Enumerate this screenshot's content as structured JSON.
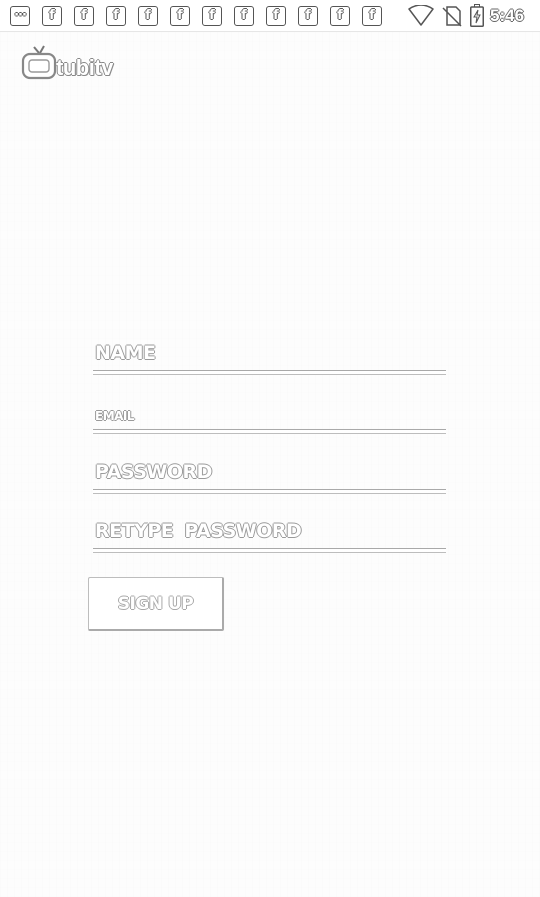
{
  "status_bar": {
    "notifications": [
      {
        "icon": "more-dots-icon",
        "glyph": "···"
      },
      {
        "icon": "facebook-icon",
        "glyph": "f"
      },
      {
        "icon": "facebook-icon",
        "glyph": "f"
      },
      {
        "icon": "facebook-icon",
        "glyph": "f"
      },
      {
        "icon": "facebook-icon",
        "glyph": "f"
      },
      {
        "icon": "facebook-icon",
        "glyph": "f"
      },
      {
        "icon": "facebook-icon",
        "glyph": "f"
      },
      {
        "icon": "facebook-icon",
        "glyph": "f"
      },
      {
        "icon": "facebook-icon",
        "glyph": "f"
      },
      {
        "icon": "facebook-icon",
        "glyph": "f"
      },
      {
        "icon": "facebook-icon",
        "glyph": "f"
      },
      {
        "icon": "facebook-icon",
        "glyph": "f"
      }
    ],
    "icons": [
      "wifi-icon",
      "no-sim-icon",
      "battery-charging-icon"
    ],
    "time": "5:46"
  },
  "app": {
    "logo_text": "tubitv",
    "logo_icon": "tv-icon"
  },
  "form": {
    "name_placeholder": "NAME",
    "email_placeholder": "EMAIL",
    "password_placeholder": "PASSWORD",
    "retype_password_placeholder": "RETYPE PASSWORD",
    "name_value": "",
    "email_value": "",
    "password_value": "",
    "retype_password_value": "",
    "signup_label": "SIGN UP"
  }
}
